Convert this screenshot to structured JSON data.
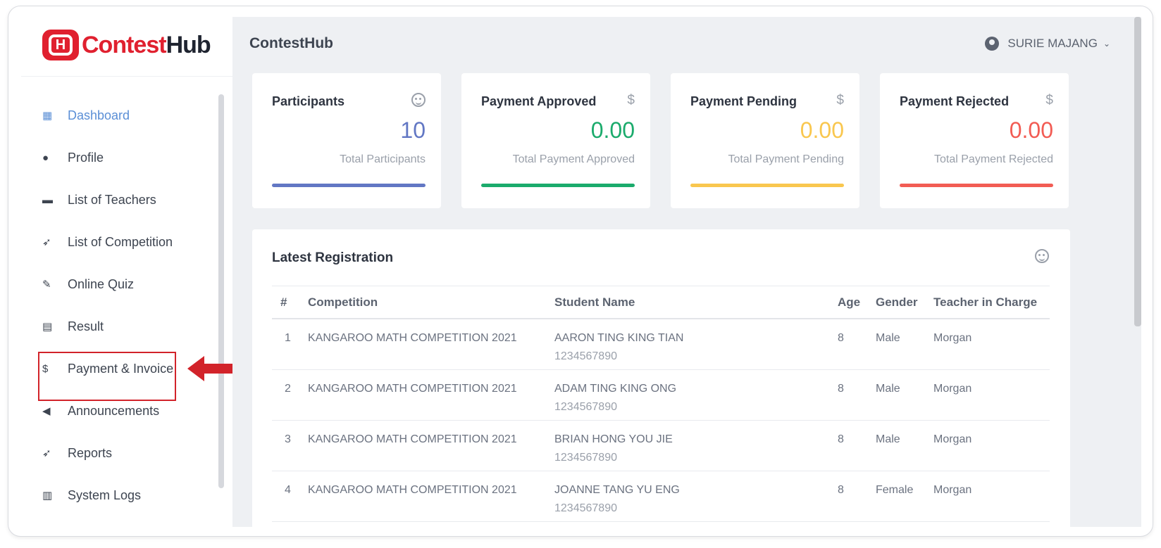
{
  "logo": {
    "part1": "Contest",
    "part2": "Hub",
    "mark": "H"
  },
  "sidebar": {
    "items": [
      {
        "label": "Dashboard",
        "icon": "dashboard-icon",
        "glyph": "▦",
        "active": true
      },
      {
        "label": "Profile",
        "icon": "user-circle-icon",
        "glyph": "●"
      },
      {
        "label": "List of Teachers",
        "icon": "id-card-icon",
        "glyph": "▬"
      },
      {
        "label": "List of Competition",
        "icon": "rocket-icon",
        "glyph": "➶"
      },
      {
        "label": "Online Quiz",
        "icon": "pencil-icon",
        "glyph": "✎"
      },
      {
        "label": "Result",
        "icon": "document-icon",
        "glyph": "▤"
      },
      {
        "label": "Payment & Invoice",
        "icon": "dollar-icon",
        "glyph": "$"
      },
      {
        "label": "Announcements",
        "icon": "megaphone-icon",
        "glyph": "◀"
      },
      {
        "label": "Reports",
        "icon": "rocket-icon",
        "glyph": "➶"
      },
      {
        "label": "System Logs",
        "icon": "list-icon",
        "glyph": "▥"
      }
    ]
  },
  "header": {
    "title": "ContestHub",
    "user": "SURIE MAJANG"
  },
  "cards": [
    {
      "label": "Participants",
      "value": "10",
      "sub": "Total Participants",
      "color": "#6277c4",
      "icon": "smiley-icon"
    },
    {
      "label": "Payment Approved",
      "value": "0.00",
      "sub": "Total Payment Approved",
      "color": "#1bab6c",
      "icon": "dollar-icon"
    },
    {
      "label": "Payment Pending",
      "value": "0.00",
      "sub": "Total Payment Pending",
      "color": "#f9c74f",
      "icon": "dollar-icon"
    },
    {
      "label": "Payment Rejected",
      "value": "0.00",
      "sub": "Total Payment Rejected",
      "color": "#f25c54",
      "icon": "dollar-icon"
    }
  ],
  "latest": {
    "title": "Latest Registration",
    "columns": [
      "#",
      "Competition",
      "Student Name",
      "Age",
      "Gender",
      "Teacher in Charge"
    ],
    "rows": [
      {
        "num": "1",
        "competition": "KANGAROO MATH COMPETITION 2021",
        "name": "AARON TING KING TIAN",
        "phone": "1234567890",
        "age": "8",
        "gender": "Male",
        "teacher": "Morgan"
      },
      {
        "num": "2",
        "competition": "KANGAROO MATH COMPETITION 2021",
        "name": "ADAM TING KING ONG",
        "phone": "1234567890",
        "age": "8",
        "gender": "Male",
        "teacher": "Morgan"
      },
      {
        "num": "3",
        "competition": "KANGAROO MATH COMPETITION 2021",
        "name": "BRIAN HONG YOU JIE",
        "phone": "1234567890",
        "age": "8",
        "gender": "Male",
        "teacher": "Morgan"
      },
      {
        "num": "4",
        "competition": "KANGAROO MATH COMPETITION 2021",
        "name": "JOANNE TANG YU ENG",
        "phone": "1234567890",
        "age": "8",
        "gender": "Female",
        "teacher": "Morgan"
      }
    ]
  },
  "colors": {
    "accent": "#5b8fd6",
    "brand": "#e0202f",
    "highlight": "#d2232a"
  }
}
